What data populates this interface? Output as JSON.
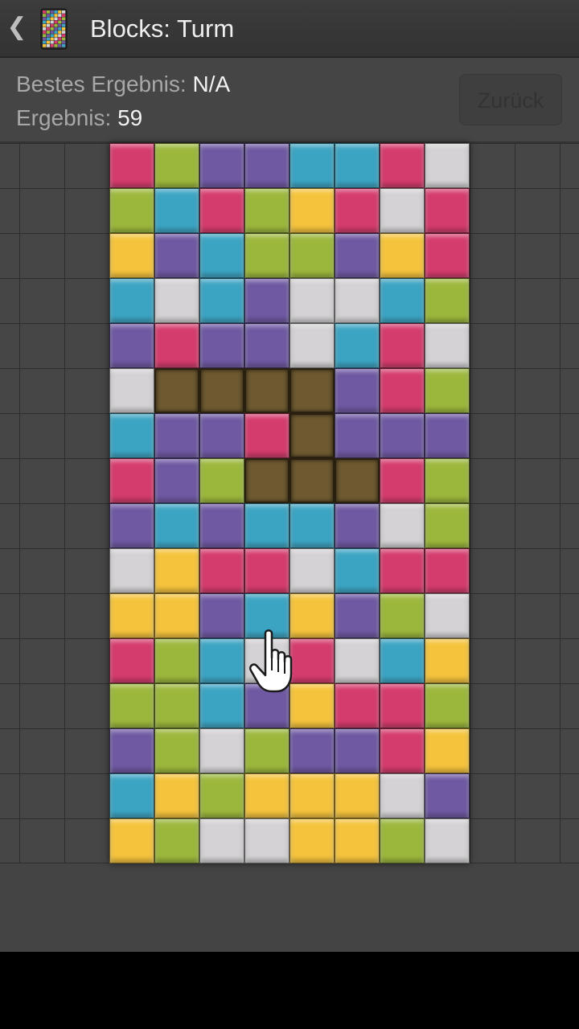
{
  "actionbar": {
    "back_icon": "chevron-left-icon",
    "back_glyph": "❮",
    "app_icon": "tower-blocks-icon",
    "title": "Blocks: Turm"
  },
  "score": {
    "best_label": "Bestes Ergebnis: ",
    "best_value": "N/A",
    "current_label": "Ergebnis: ",
    "current_value": "59",
    "back_button": "Zurück"
  },
  "colors": {
    "R": "#d53c6e",
    "G": "#9cb83c",
    "P": "#6e59a2",
    "B": "#3ca4c3",
    "Y": "#f6c43c",
    "W": "#d4d2d4",
    "S": "#6e5a30"
  },
  "board": {
    "columns": 8,
    "rows": [
      "RGPPBBRW",
      "GBRGYRWR",
      "YPBGGPYR",
      "BWBPWWBG",
      "PRPPWBRW",
      "WSSSSPRG",
      "BPPRSPPP",
      "RPGSSSRG",
      "PBPBBPWG",
      "WYRRWBRR",
      "YYPBYPGW",
      "RGBWRWBY",
      "GGBPYRRG",
      "PGWGPPRY",
      "BYGYYYWP",
      "YGWWYYGW"
    ]
  },
  "cursor_icon": "hand-pointer-icon"
}
